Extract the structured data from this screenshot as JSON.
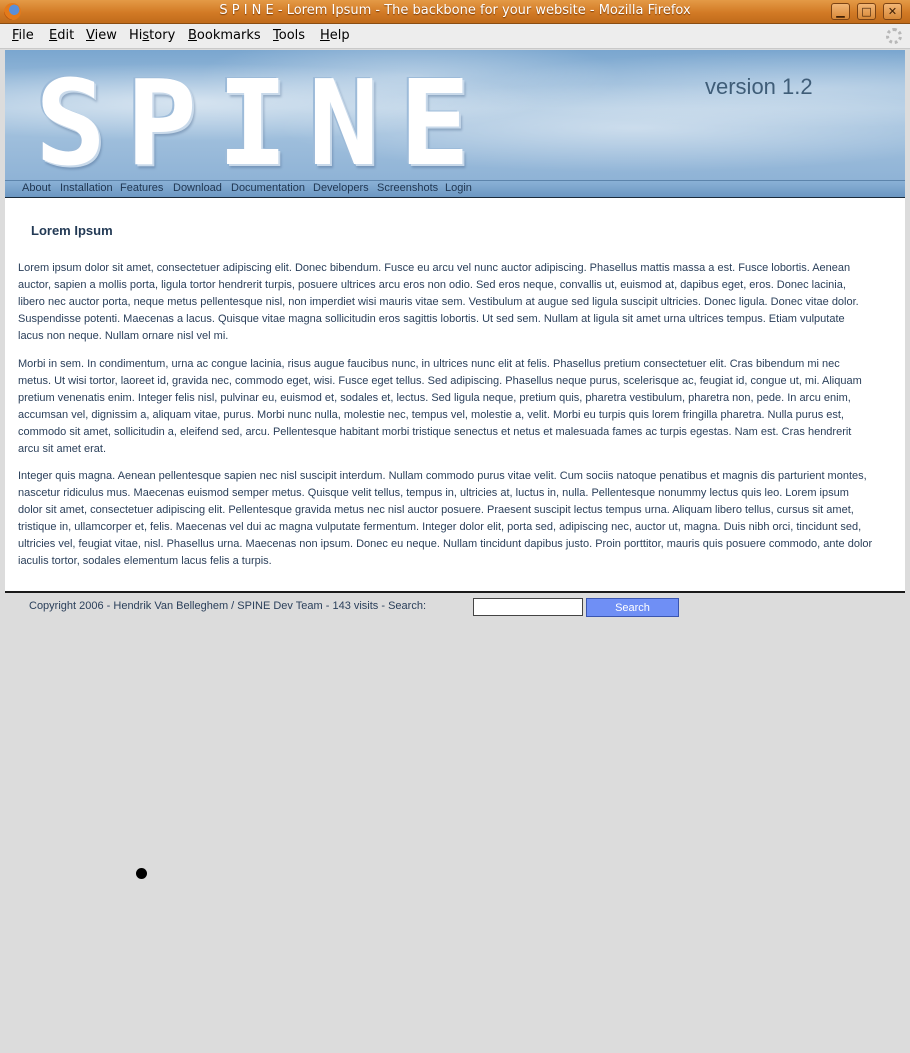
{
  "window": {
    "title": "S P I N E - Lorem Ipsum - The backbone for your website - Mozilla Firefox",
    "buttons": {
      "minimize": "▁",
      "maximize": "□",
      "close": "✕"
    }
  },
  "menubar": {
    "items": [
      {
        "label": "File",
        "accel": "F",
        "rest": "ile"
      },
      {
        "label": "Edit",
        "accel": "E",
        "rest": "dit"
      },
      {
        "label": "View",
        "accel": "V",
        "rest": "iew"
      },
      {
        "label": "History",
        "accel": "",
        "pre": "Hi",
        "accel2": "s",
        "rest": "tory"
      },
      {
        "label": "Bookmarks",
        "accel": "B",
        "rest": "ookmarks"
      },
      {
        "label": "Tools",
        "accel": "T",
        "rest": "ools"
      },
      {
        "label": "Help",
        "accel": "H",
        "rest": "elp"
      }
    ]
  },
  "header": {
    "logo_text": "SPINE",
    "version": "version 1.2"
  },
  "nav": {
    "items": [
      "About",
      "Installation",
      "Features",
      "Download",
      "Documentation",
      "Developers",
      "Screenshots",
      "Login"
    ]
  },
  "main": {
    "heading": "Lorem Ipsum",
    "paragraphs": [
      "Lorem ipsum dolor sit amet, consectetuer adipiscing elit. Donec bibendum. Fusce eu arcu vel nunc auctor adipiscing. Phasellus mattis massa a est. Fusce lobortis. Aenean auctor, sapien a mollis porta, ligula tortor hendrerit turpis, posuere ultrices arcu eros non odio. Sed eros neque, convallis ut, euismod at, dapibus eget, eros. Donec lacinia, libero nec auctor porta, neque metus pellentesque nisl, non imperdiet wisi mauris vitae sem. Vestibulum at augue sed ligula suscipit ultricies. Donec ligula. Donec vitae dolor. Suspendisse potenti. Maecenas a lacus. Quisque vitae magna sollicitudin eros sagittis lobortis. Ut sed sem. Nullam at ligula sit amet urna ultrices tempus. Etiam vulputate lacus non neque. Nullam ornare nisl vel mi.",
      "Morbi in sem. In condimentum, urna ac congue lacinia, risus augue faucibus nunc, in ultrices nunc elit at felis. Phasellus pretium consectetuer elit. Cras bibendum mi nec metus. Ut wisi tortor, laoreet id, gravida nec, commodo eget, wisi. Fusce eget tellus. Sed adipiscing. Phasellus neque purus, scelerisque ac, feugiat id, congue ut, mi. Aliquam pretium venenatis enim. Integer felis nisl, pulvinar eu, euismod et, sodales et, lectus. Sed ligula neque, pretium quis, pharetra vestibulum, pharetra non, pede. In arcu enim, accumsan vel, dignissim a, aliquam vitae, purus. Morbi nunc nulla, molestie nec, tempus vel, molestie a, velit. Morbi eu turpis quis lorem fringilla pharetra. Nulla purus est, commodo sit amet, sollicitudin a, eleifend sed, arcu. Pellentesque habitant morbi tristique senectus et netus et malesuada fames ac turpis egestas. Nam est. Cras hendrerit arcu sit amet erat.",
      "Integer quis magna. Aenean pellentesque sapien nec nisl suscipit interdum. Nullam commodo purus vitae velit. Cum sociis natoque penatibus et magnis dis parturient montes, nascetur ridiculus mus. Maecenas euismod semper metus. Quisque velit tellus, tempus in, ultricies at, luctus in, nulla. Pellentesque nonummy lectus quis leo. Lorem ipsum dolor sit amet, consectetuer adipiscing elit. Pellentesque gravida metus nec nisl auctor posuere. Praesent suscipit lectus tempus urna. Aliquam libero tellus, cursus sit amet, tristique in, ullamcorper et, felis. Maecenas vel dui ac magna vulputate fermentum. Integer dolor elit, porta sed, adipiscing nec, auctor ut, magna. Duis nibh orci, tincidunt sed, ultricies vel, feugiat vitae, nisl. Phasellus urna. Maecenas non ipsum. Donec eu neque. Nullam tincidunt dapibus justo. Proin porttitor, mauris quis posuere commodo, ante dolor iaculis tortor, sodales elementum lacus felis a turpis."
    ]
  },
  "footer": {
    "text": "Copyright 2006 - Hendrik Van Belleghem / SPINE Dev Team - 143 visits - Search:",
    "search_value": "",
    "search_button": "Search"
  },
  "colors": {
    "titlebar": "#d27a25",
    "nav_bg": "#7aa3cc",
    "text": "#2a3f5a",
    "search_button": "#6f8ff5"
  }
}
